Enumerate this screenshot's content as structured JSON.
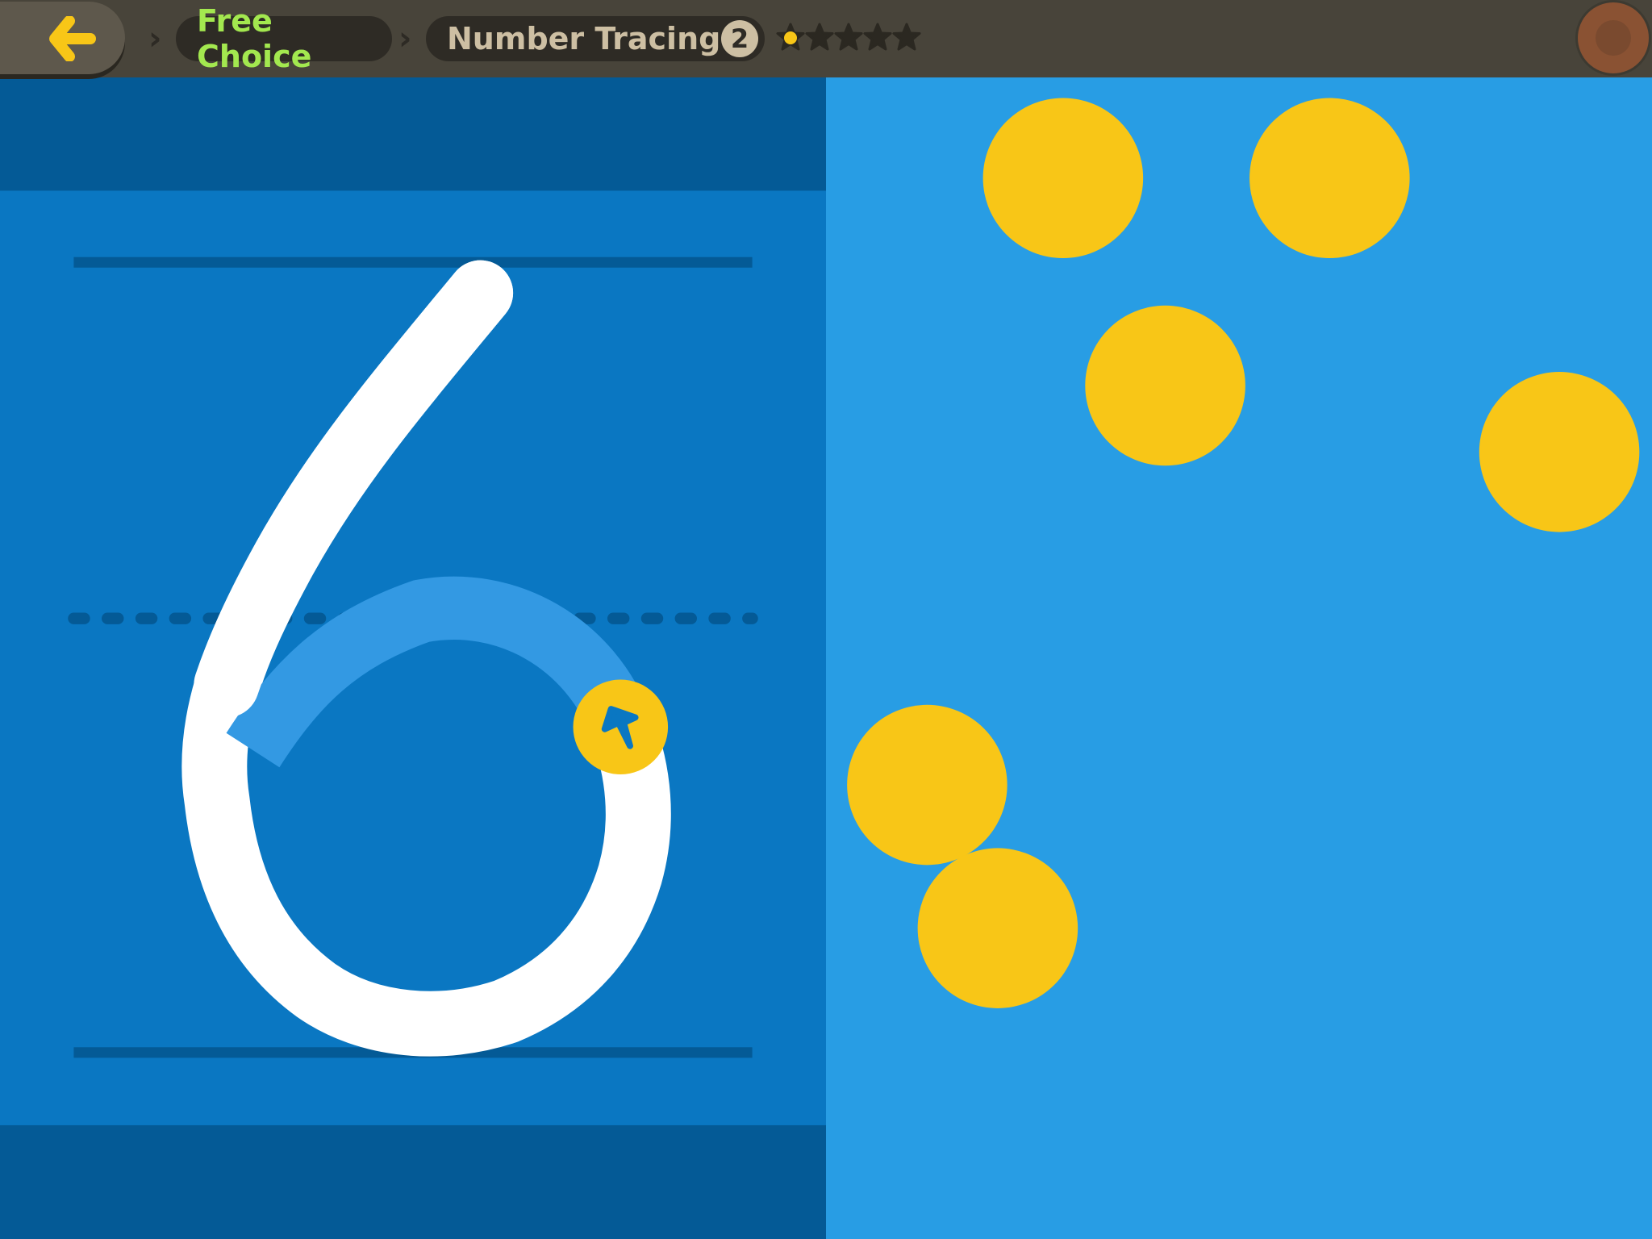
{
  "topbar": {
    "back_icon": "arrow-left-icon",
    "breadcrumb": [
      {
        "label": "Free Choice"
      },
      {
        "label": "Number Tracing",
        "badge": "2"
      }
    ],
    "stars": {
      "filled": 1,
      "total": 5
    },
    "record_icon": "record-button-icon"
  },
  "activity": {
    "digit": "6",
    "counters": 6,
    "cursor_icon": "arrow-cursor-icon"
  },
  "colors": {
    "topbar": "#48443a",
    "trace_panel": "#0a77c2",
    "trace_band": "#045a96",
    "count_panel": "#289de4",
    "counter": "#f8c617",
    "trace_progress": "#3399e3",
    "free_choice_text": "#a3e84f"
  }
}
